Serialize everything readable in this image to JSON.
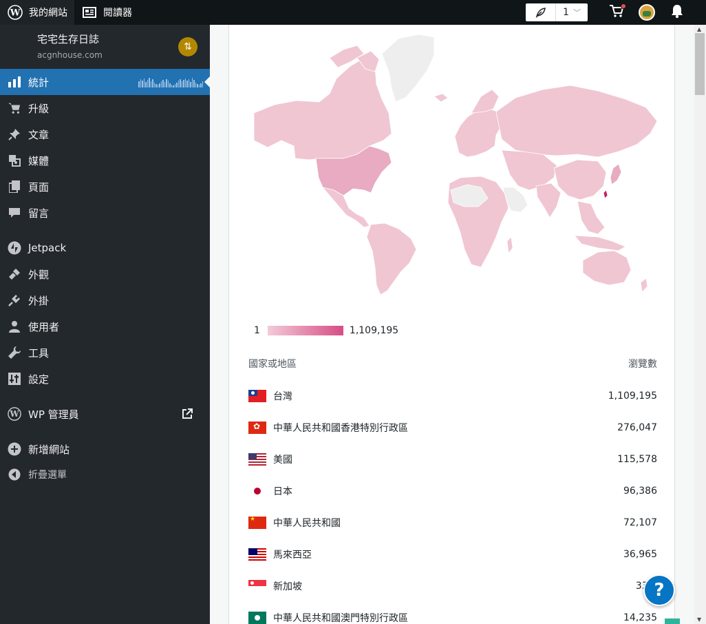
{
  "topbar": {
    "my_site": "我的網站",
    "reader": "閱讀器",
    "status_count": "1"
  },
  "site": {
    "name": "宅宅生存日誌",
    "url": "acgnhouse.com"
  },
  "nav": {
    "stats": "統計",
    "upgrades": "升級",
    "posts": "文章",
    "media": "媒體",
    "pages": "頁面",
    "comments": "留言",
    "jetpack": "Jetpack",
    "appearance": "外觀",
    "plugins": "外掛",
    "users": "使用者",
    "tools": "工具",
    "settings": "設定",
    "wp_admin": "WP 管理員",
    "add_site": "新增網站",
    "collapse": "折疊選單"
  },
  "legend": {
    "min": "1",
    "max": "1,109,195"
  },
  "table": {
    "col_country": "國家或地區",
    "col_views": "瀏覽數",
    "rows": [
      {
        "name": "台灣",
        "views": "1,109,195"
      },
      {
        "name": "中華人民共和國香港特別行政區",
        "views": "276,047"
      },
      {
        "name": "美國",
        "views": "115,578"
      },
      {
        "name": "日本",
        "views": "96,386"
      },
      {
        "name": "中華人民共和國",
        "views": "72,107"
      },
      {
        "name": "馬來西亞",
        "views": "36,965"
      },
      {
        "name": "新加坡",
        "views": "33,9"
      },
      {
        "name": "中華人民共和國澳門特別行政區",
        "views": "14,235"
      }
    ]
  },
  "help": "?",
  "colors": {
    "accent": "#2271b1",
    "sidebar": "#23282d",
    "map_low": "#f3cbd8",
    "map_high": "#d64d85",
    "map_none": "#eeeeee"
  }
}
